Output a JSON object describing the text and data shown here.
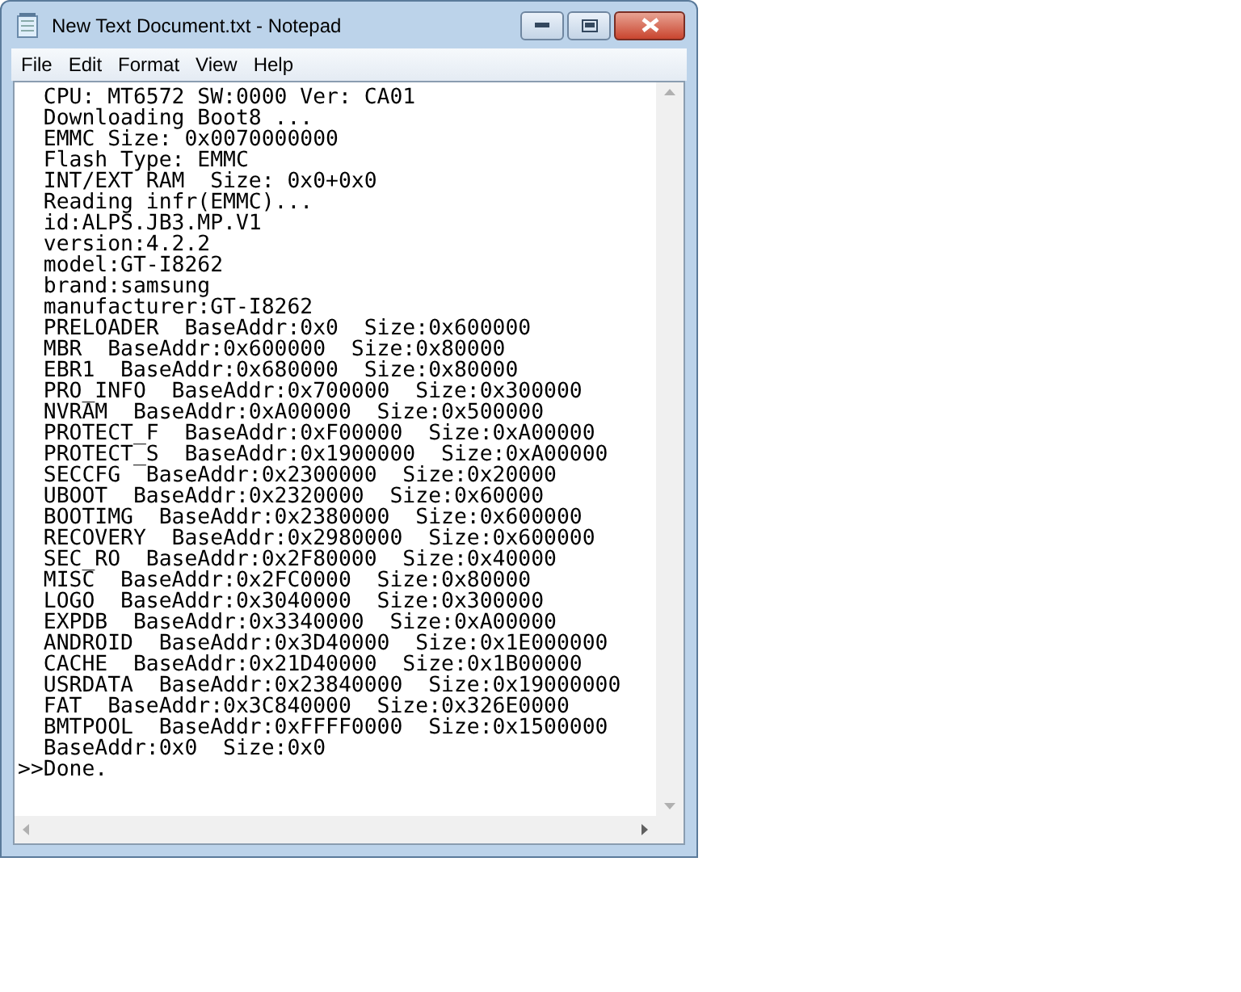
{
  "window": {
    "title": "New Text Document.txt - Notepad"
  },
  "menu": [
    "File",
    "Edit",
    "Format",
    "View",
    "Help"
  ],
  "lines": [
    "  CPU: MT6572 SW:0000 Ver: CA01",
    "  Downloading Boot8 ...",
    "  EMMC Size: 0x0070000000",
    "  Flash Type: EMMC",
    "  INT/EXT RAM  Size: 0x0+0x0",
    "  Reading infr(EMMC)...",
    "  id:ALPS.JB3.MP.V1",
    "  version:4.2.2",
    "  model:GT-I8262",
    "  brand:samsung",
    "  manufacturer:GT-I8262",
    "  PRELOADER  BaseAddr:0x0  Size:0x600000",
    "  MBR  BaseAddr:0x600000  Size:0x80000",
    "  EBR1  BaseAddr:0x680000  Size:0x80000",
    "  PRO_INFO  BaseAddr:0x700000  Size:0x300000",
    "  NVRAM  BaseAddr:0xA00000  Size:0x500000",
    "  PROTECT_F  BaseAddr:0xF00000  Size:0xA00000",
    "  PROTECT_S  BaseAddr:0x1900000  Size:0xA00000",
    "  SECCFG  BaseAddr:0x2300000  Size:0x20000",
    "  UBOOT  BaseAddr:0x2320000  Size:0x60000",
    "  BOOTIMG  BaseAddr:0x2380000  Size:0x600000",
    "  RECOVERY  BaseAddr:0x2980000  Size:0x600000",
    "  SEC_RO  BaseAddr:0x2F80000  Size:0x40000",
    "  MISC  BaseAddr:0x2FC0000  Size:0x80000",
    "  LOGO  BaseAddr:0x3040000  Size:0x300000",
    "  EXPDB  BaseAddr:0x3340000  Size:0xA00000",
    "  ANDROID  BaseAddr:0x3D40000  Size:0x1E000000",
    "  CACHE  BaseAddr:0x21D40000  Size:0x1B00000",
    "  USRDATA  BaseAddr:0x23840000  Size:0x19000000",
    "  FAT  BaseAddr:0x3C840000  Size:0x326E0000",
    "  BMTPOOL  BaseAddr:0xFFFF0000  Size:0x1500000",
    "  BaseAddr:0x0  Size:0x0",
    ">>Done."
  ]
}
